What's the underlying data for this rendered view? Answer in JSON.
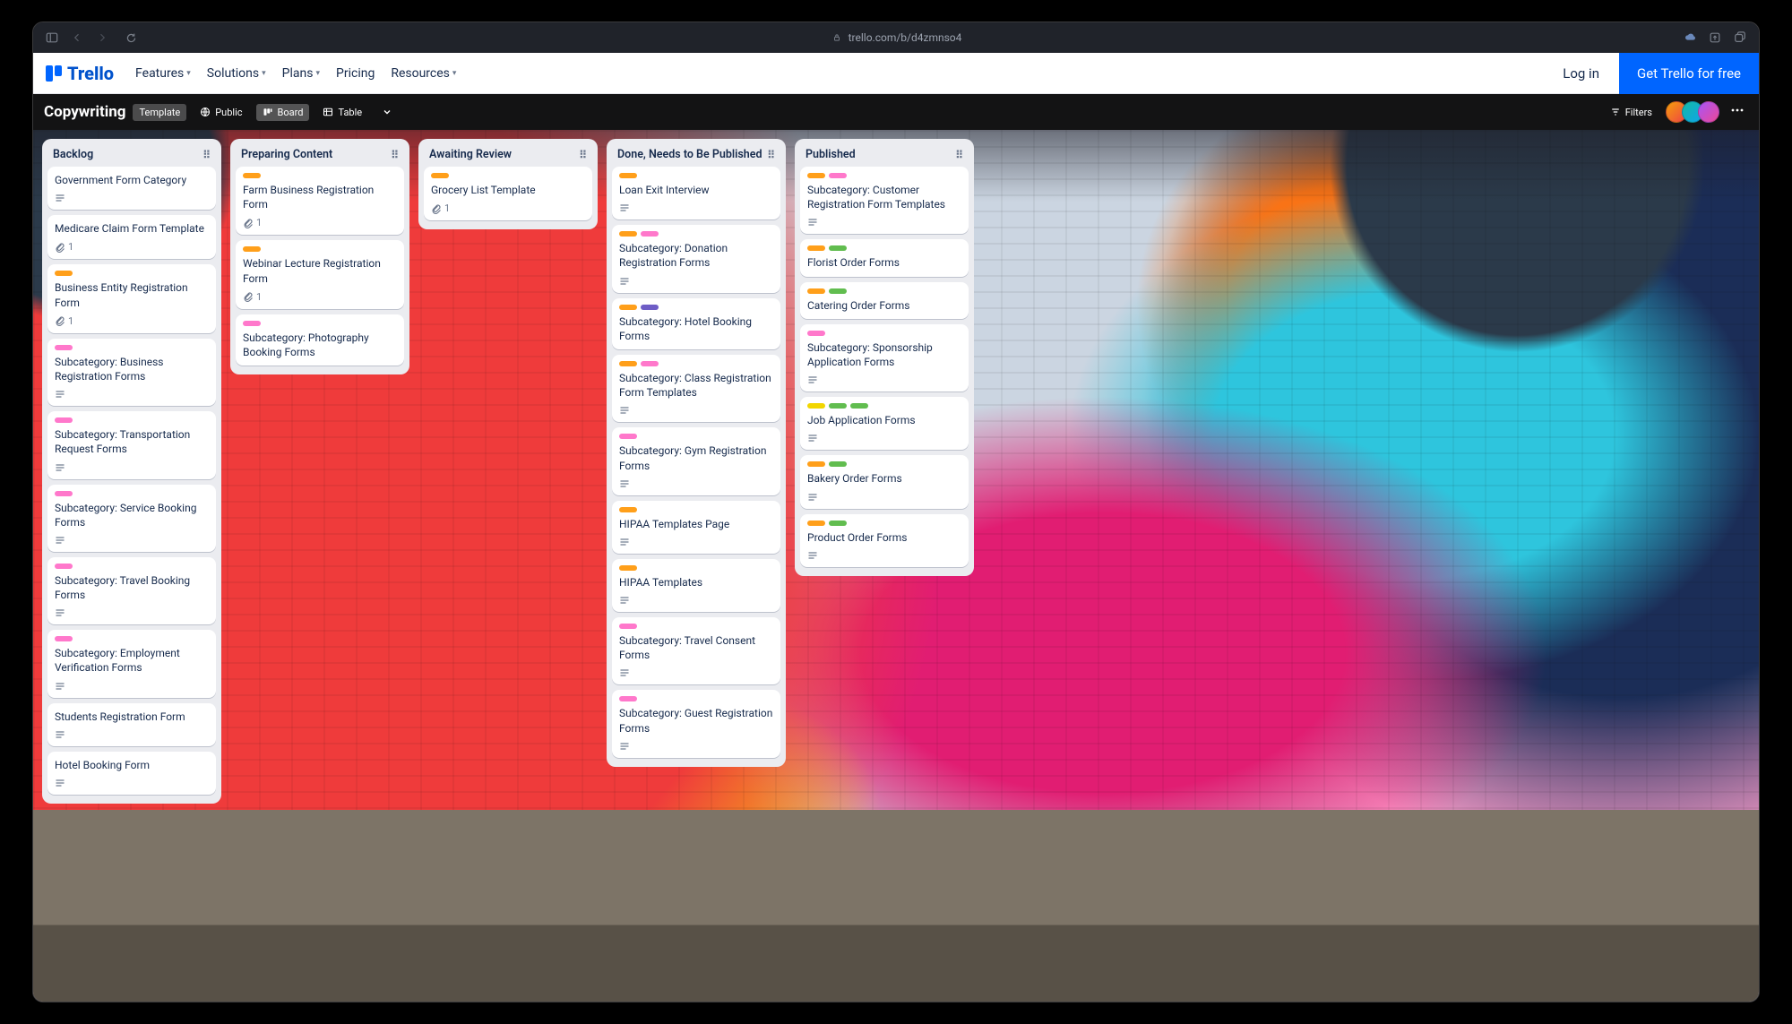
{
  "browser": {
    "url": "trello.com/b/d4zmnso4"
  },
  "top_nav": {
    "logo_text": "Trello",
    "menu": [
      "Features",
      "Solutions",
      "Plans",
      "Pricing",
      "Resources"
    ],
    "menu_has_dropdown": [
      true,
      true,
      true,
      false,
      true
    ],
    "login": "Log in",
    "cta": "Get Trello for free"
  },
  "board_header": {
    "title": "Copywriting",
    "template_chip": "Template",
    "visibility": "Public",
    "views": {
      "board": "Board",
      "table": "Table"
    },
    "filters_label": "Filters"
  },
  "lists": [
    {
      "name": "Backlog",
      "cards": [
        {
          "labels": [],
          "title": "Government Form Category",
          "has_desc": true,
          "attachments": 0
        },
        {
          "labels": [],
          "title": "Medicare Claim Form Template",
          "has_desc": false,
          "attachments": 1
        },
        {
          "labels": [
            "orange"
          ],
          "title": "Business Entity Registration Form",
          "has_desc": false,
          "attachments": 1
        },
        {
          "labels": [
            "pink"
          ],
          "title": "Subcategory: Business Registration Forms",
          "has_desc": true,
          "attachments": 0
        },
        {
          "labels": [
            "pink"
          ],
          "title": "Subcategory: Transportation Request Forms",
          "has_desc": true,
          "attachments": 0
        },
        {
          "labels": [
            "pink"
          ],
          "title": "Subcategory: Service Booking Forms",
          "has_desc": true,
          "attachments": 0
        },
        {
          "labels": [
            "pink"
          ],
          "title": "Subcategory: Travel Booking Forms",
          "has_desc": true,
          "attachments": 0
        },
        {
          "labels": [
            "pink"
          ],
          "title": "Subcategory: Employment Verification Forms",
          "has_desc": true,
          "attachments": 0
        },
        {
          "labels": [],
          "title": "Students Registration Form",
          "has_desc": true,
          "attachments": 0
        },
        {
          "labels": [],
          "title": "Hotel Booking Form",
          "has_desc": true,
          "attachments": 0
        }
      ]
    },
    {
      "name": "Preparing Content",
      "cards": [
        {
          "labels": [
            "orange"
          ],
          "title": "Farm Business Registration Form",
          "has_desc": false,
          "attachments": 1
        },
        {
          "labels": [
            "orange"
          ],
          "title": "Webinar Lecture Registration Form",
          "has_desc": false,
          "attachments": 1
        },
        {
          "labels": [
            "pink"
          ],
          "title": "Subcategory: Photography Booking Forms",
          "has_desc": false,
          "attachments": 0
        }
      ]
    },
    {
      "name": "Awaiting Review",
      "cards": [
        {
          "labels": [
            "orange"
          ],
          "title": "Grocery List Template",
          "has_desc": false,
          "attachments": 1
        }
      ]
    },
    {
      "name": "Done, Needs to Be Published",
      "cards": [
        {
          "labels": [
            "orange"
          ],
          "title": "Loan Exit Interview",
          "has_desc": true,
          "attachments": 0
        },
        {
          "labels": [
            "orange",
            "pink"
          ],
          "title": "Subcategory: Donation Registration Forms",
          "has_desc": true,
          "attachments": 0
        },
        {
          "labels": [
            "orange",
            "purple"
          ],
          "title": "Subcategory: Hotel Booking Forms",
          "has_desc": false,
          "attachments": 0
        },
        {
          "labels": [
            "orange",
            "pink"
          ],
          "title": "Subcategory: Class Registration Form Templates",
          "has_desc": true,
          "attachments": 0
        },
        {
          "labels": [
            "pink"
          ],
          "title": "Subcategory: Gym Registration Forms",
          "has_desc": true,
          "attachments": 0
        },
        {
          "labels": [
            "orange"
          ],
          "title": "HIPAA Templates Page",
          "has_desc": true,
          "attachments": 0
        },
        {
          "labels": [
            "orange"
          ],
          "title": "HIPAA Templates",
          "has_desc": true,
          "attachments": 0
        },
        {
          "labels": [
            "pink"
          ],
          "title": "Subcategory: Travel Consent Forms",
          "has_desc": true,
          "attachments": 0
        },
        {
          "labels": [
            "pink"
          ],
          "title": "Subcategory: Guest Registration Forms",
          "has_desc": true,
          "attachments": 0
        }
      ]
    },
    {
      "name": "Published",
      "cards": [
        {
          "labels": [
            "orange",
            "pink"
          ],
          "title": "Subcategory: Customer Registration Form Templates",
          "has_desc": true,
          "attachments": 0
        },
        {
          "labels": [
            "orange",
            "green"
          ],
          "title": "Florist Order Forms",
          "has_desc": false,
          "attachments": 0
        },
        {
          "labels": [
            "orange",
            "green"
          ],
          "title": "Catering Order Forms",
          "has_desc": false,
          "attachments": 0
        },
        {
          "labels": [
            "pink"
          ],
          "title": "Subcategory: Sponsorship Application Forms",
          "has_desc": true,
          "attachments": 0
        },
        {
          "labels": [
            "yellow",
            "green",
            "green"
          ],
          "title": "Job Application Forms",
          "has_desc": true,
          "attachments": 0
        },
        {
          "labels": [
            "orange",
            "green"
          ],
          "title": "Bakery Order Forms",
          "has_desc": true,
          "attachments": 0
        },
        {
          "labels": [
            "orange",
            "green"
          ],
          "title": "Product Order Forms",
          "has_desc": true,
          "attachments": 0
        }
      ]
    }
  ]
}
